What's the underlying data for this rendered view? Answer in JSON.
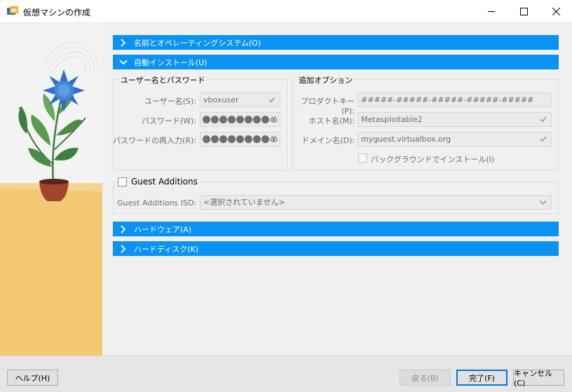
{
  "window": {
    "title": "仮想マシンの作成"
  },
  "sections": {
    "name_os": "名前とオペレーティングシステム(O)",
    "unattended": "自動インストール(U)",
    "hardware": "ハードウェア(A)",
    "hard_disk": "ハードディスク(K)"
  },
  "user_group": {
    "title": "ユーザー名とパスワード",
    "username_label": "ユーザー名(S):",
    "username_value": "vboxuser",
    "password_label": "パスワード(W):",
    "password_repeat_label": "パスワードの再入力(R):"
  },
  "options_group": {
    "title": "追加オプション",
    "product_key_label": "プロダクトキー(P):",
    "product_key_placeholder": "#####-#####-#####-#####-#####",
    "hostname_label": "ホスト名(M):",
    "hostname_value": "Metasploitable2",
    "domain_label": "ドメイン名(D):",
    "domain_value": "myguest.virtualbox.org",
    "background_install_label": "バックグラウンドでインストール(I)"
  },
  "guest_additions": {
    "label": "Guest Additions",
    "iso_label": "Guest Additions ISO:",
    "iso_value": "<選択されていません>"
  },
  "buttons": {
    "help": "ヘルプ(H)",
    "back": "戻る(B)",
    "finish": "完了(F)",
    "cancel": "キャンセル(C)"
  },
  "colors": {
    "section_bar": "#0a93f3",
    "accent": "#0078d7"
  }
}
